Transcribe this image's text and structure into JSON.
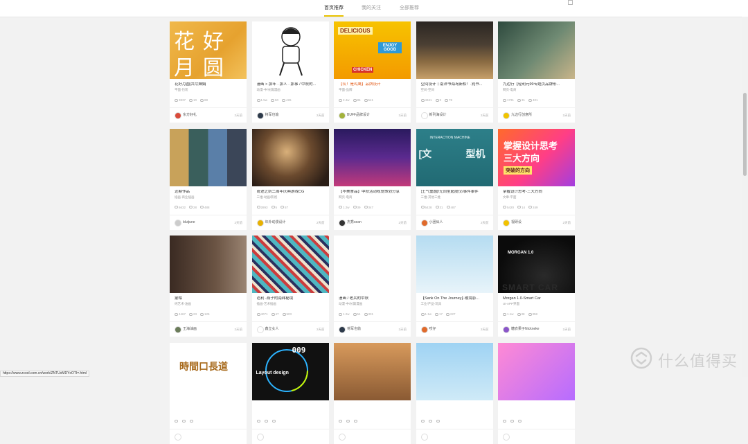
{
  "tabs": [
    {
      "label": "首页推荐",
      "active": true
    },
    {
      "label": "我的关注",
      "active": false
    },
    {
      "label": "全部推荐",
      "active": false
    }
  ],
  "status_url": "https://www.zcool.com.cn/work/ZNTUxMDYxOTI=.html",
  "watermark": "什么值得买",
  "overlays": {
    "c0_chars": [
      "花",
      "好",
      "月",
      "圆"
    ],
    "c2_badge": "DELICIOUS",
    "c2_cup": "ENJOY GOOD",
    "c2_bag": "CHICKEN",
    "c8_head": "[文",
    "c8_tail": "型机",
    "c8_small": "INTERACTION MACHINE",
    "c9_title1": "掌握设计思考",
    "c9_title2": "三大方向",
    "c9_sub": "突破的方向",
    "c14_title": "MORGAN 1.0",
    "c14_car": "SMART CAR",
    "c16_text": "Layout design",
    "c16_num": "009",
    "c15_chars": "時間口長道"
  },
  "cards": [
    {
      "title": "花好月圆|共尽婵娟",
      "sub": "平面-包装",
      "views": "3837",
      "comments": "10",
      "likes": "88",
      "author": "东方好礼",
      "time": "2天前",
      "avatar": "#d94b3b"
    },
    {
      "title": "漫画 > 那年 · 那人 · 那事 / 中秋的...",
      "sub": "动漫-中/长篇漫画",
      "views": "1.5w",
      "comments": "50",
      "likes": "426",
      "author": "将军也偷",
      "time": "2天前",
      "avatar": "#2d3a4a"
    },
    {
      "title": "【哎！是鸡鹰】品牌设计",
      "sub": "平面-品牌",
      "views": "2.4w",
      "comments": "86",
      "likes": "541",
      "author": "BUFF品牌设计",
      "time": "2天前",
      "avatar": "#a3b23b",
      "hl": true
    },
    {
      "title": "空间设计丨南洋书海岛新松！·霓书...",
      "sub": "空间-空间",
      "views": "4341",
      "comments": "3",
      "likes": "78",
      "author": "新列海设计",
      "time": "2天前",
      "avatar": "#ffffff"
    },
    {
      "title": "九边行【轻利元99专题页品牌形...",
      "sub": "网页-电商",
      "views": "1731",
      "comments": "31",
      "likes": "401",
      "author": "九边行创意所",
      "time": "2天前",
      "avatar": "#f0c400"
    },
    {
      "title": "近期作品",
      "sub": "插画-商业插画",
      "views": "6632",
      "comments": "28",
      "likes": "488",
      "author": "blutjune",
      "time": "2天前",
      "avatar": "#cccccc"
    },
    {
      "title": "奇迹之剑二周年庆典游戏CG",
      "sub": "三维-动画/影视",
      "views": "2893",
      "comments": "5",
      "likes": "57",
      "author": "年外动漫设计",
      "time": "2天前",
      "avatar": "#e8b100"
    },
    {
      "title": "【华美食品】中秋活动视觉策划分享",
      "sub": "网页-电商",
      "views": "1.2w",
      "comments": "39",
      "likes": "347",
      "author": "杰秀sean",
      "time": "2天前",
      "avatar": "#333333"
    },
    {
      "title": "[土气重圆]!无同型超度仪/事件事件",
      "sub": "三维-其他三维",
      "views": "5428",
      "comments": "31",
      "likes": "487",
      "author": "小团似人",
      "time": "2天前",
      "avatar": "#e06a2b"
    },
    {
      "title": "掌握设计思考-三大方向",
      "sub": "文章-平面",
      "views": "5420",
      "comments": "14",
      "likes": "249",
      "author": "视研设",
      "time": "2天前",
      "avatar": "#f2c200"
    },
    {
      "title": "蒙帕",
      "sub": "纯艺术-油画",
      "views": "4467",
      "comments": "23",
      "likes": "125",
      "author": "王海油画",
      "time": "2天前",
      "avatar": "#6b7c5a"
    },
    {
      "title": "达利 -燕子的南纬秘境",
      "sub": "插画-艺术插画",
      "views": "4071",
      "comments": "47",
      "likes": "503",
      "author": "鑫立女人",
      "time": "2天前",
      "avatar": "#ffffff"
    },
    {
      "title": "漫画 / 老兵的中秋",
      "sub": "动漫-中/长篇漫画",
      "views": "1.2w",
      "comments": "54",
      "likes": "331",
      "author": "将军也偷",
      "time": "2天前",
      "avatar": "#2d3a4a"
    },
    {
      "title": "【Sank On The Journey】·缓境影...",
      "sub": "工业/产品-玩具",
      "views": "1.1w",
      "comments": "17",
      "likes": "227",
      "author": "哎仔",
      "time": "2天前",
      "avatar": "#e06a2b"
    },
    {
      "title": "Morgan 1.0-Smart Car",
      "sub": "UI-APP界面",
      "views": "1.1w",
      "comments": "38",
      "likes": "358",
      "author": "糖衣果子Nickneke",
      "time": "2天前",
      "avatar": "#8a55c9"
    },
    {
      "title": "",
      "sub": "",
      "views": "",
      "comments": "",
      "likes": "",
      "author": "",
      "time": "",
      "avatar": "#ffffff"
    },
    {
      "title": "",
      "sub": "",
      "views": "",
      "comments": "",
      "likes": "",
      "author": "",
      "time": "",
      "avatar": "#ffffff"
    },
    {
      "title": "",
      "sub": "",
      "views": "",
      "comments": "",
      "likes": "",
      "author": "",
      "time": "",
      "avatar": "#ffffff"
    },
    {
      "title": "",
      "sub": "",
      "views": "",
      "comments": "",
      "likes": "",
      "author": "",
      "time": "",
      "avatar": "#ffffff"
    },
    {
      "title": "",
      "sub": "",
      "views": "",
      "comments": "",
      "likes": "",
      "author": "",
      "time": "",
      "avatar": "#ffffff"
    }
  ]
}
